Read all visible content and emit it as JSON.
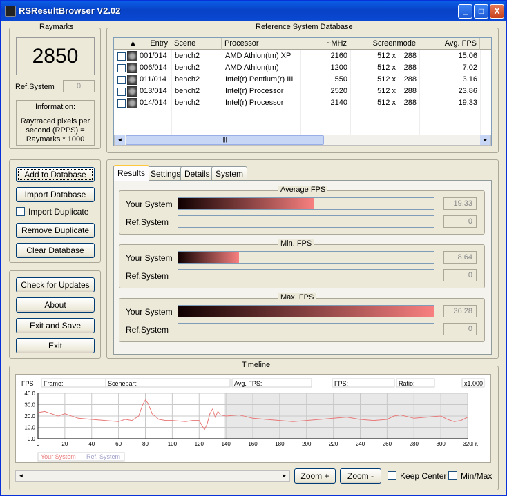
{
  "window": {
    "title": "RSResultBrowser V2.02",
    "minimize": "_",
    "maximize": "□",
    "close": "X"
  },
  "raymarks": {
    "label": "Raymarks",
    "score": "2850",
    "ref_label": "Ref.System",
    "ref_value": "0",
    "info_title": "Information:",
    "info_text": "Raytraced pixels per second (RPPS) = Raymarks * 1000"
  },
  "db_buttons": {
    "add": "Add to Database",
    "import": "Import Database",
    "import_dup": "Import Duplicate",
    "remove_dup": "Remove Duplicate",
    "clear": "Clear Database"
  },
  "misc_buttons": {
    "check": "Check for Updates",
    "about": "About",
    "exit_save": "Exit and Save",
    "exit": "Exit"
  },
  "ref_db": {
    "label": "Reference System Database",
    "sort_icon": "▲",
    "columns": [
      "Entry",
      "Scene",
      "Processor",
      "~MHz",
      "Screenmode",
      "Avg. FPS"
    ],
    "rows": [
      {
        "entry": "001/014",
        "scene": "bench2",
        "processor": "AMD Athlon(tm) XP",
        "mhz": "2160",
        "w": "512 x",
        "h": "288",
        "fps": "15.06"
      },
      {
        "entry": "006/014",
        "scene": "bench2",
        "processor": "AMD Athlon(tm)",
        "mhz": "1200",
        "w": "512 x",
        "h": "288",
        "fps": "7.02"
      },
      {
        "entry": "011/014",
        "scene": "bench2",
        "processor": "Intel(r) Pentium(r) III",
        "mhz": "550",
        "w": "512 x",
        "h": "288",
        "fps": "3.16"
      },
      {
        "entry": "013/014",
        "scene": "bench2",
        "processor": "Intel(r) Processor",
        "mhz": "2520",
        "w": "512 x",
        "h": "288",
        "fps": "23.86"
      },
      {
        "entry": "014/014",
        "scene": "bench2",
        "processor": "Intel(r) Processor",
        "mhz": "2140",
        "w": "512 x",
        "h": "288",
        "fps": "19.33"
      }
    ],
    "hscroll_grip": "|||"
  },
  "tabs": [
    "Results",
    "Settings",
    "Details",
    "System"
  ],
  "results": [
    {
      "title": "Average FPS",
      "your_label": "Your System",
      "ref_label": "Ref.System",
      "your_value": "19.33",
      "ref_value": "0",
      "your_fraction": 0.532
    },
    {
      "title": "Min. FPS",
      "your_label": "Your System",
      "ref_label": "Ref.System",
      "your_value": "8.64",
      "ref_value": "0",
      "your_fraction": 0.238
    },
    {
      "title": "Max. FPS",
      "your_label": "Your System",
      "ref_label": "Ref.System",
      "your_value": "36.28",
      "ref_value": "0",
      "your_fraction": 1.0
    }
  ],
  "timeline": {
    "label": "Timeline",
    "fps_label": "FPS",
    "frame_label": "Frame:",
    "scenepart_label": "Scenepart:",
    "avgfps_label": "Avg. FPS:",
    "fps2_label": "FPS:",
    "ratio_label": "Ratio:",
    "zoom_label": "x1.000",
    "x_unit": "Fr.",
    "legend_your": "Your System",
    "legend_ref": "Ref. System",
    "grid_color": "#c8c8c8",
    "line_color": "#e87878"
  },
  "chart_data": {
    "type": "line",
    "xlabel": "Fr.",
    "ylabel": "FPS",
    "xlim": [
      0,
      320
    ],
    "ylim": [
      0,
      40
    ],
    "x_ticks": [
      0,
      20,
      40,
      60,
      80,
      100,
      120,
      140,
      160,
      180,
      200,
      220,
      240,
      260,
      280,
      300,
      320
    ],
    "y_ticks": [
      "0.0",
      "10.0",
      "20.0",
      "30.0",
      "40.0"
    ],
    "y_tick_values": [
      0,
      10,
      20,
      30,
      40
    ],
    "shaded_from": 139,
    "shaded_to": 320,
    "series": [
      {
        "name": "Your System",
        "color": "#e87878",
        "x": [
          0,
          5,
          10,
          15,
          20,
          30,
          40,
          50,
          60,
          65,
          70,
          75,
          78,
          80,
          82,
          85,
          90,
          95,
          100,
          110,
          115,
          120,
          122,
          124,
          126,
          128,
          130,
          132,
          134,
          136,
          140,
          150,
          160,
          170,
          180,
          190,
          200,
          210,
          220,
          230,
          240,
          250,
          260,
          265,
          270,
          280,
          290,
          300,
          305,
          310,
          315,
          320
        ],
        "y": [
          23,
          24,
          22,
          20,
          22,
          18,
          17,
          16,
          15,
          17,
          16,
          20,
          30,
          34,
          31,
          22,
          17,
          16,
          16,
          15,
          16,
          16,
          12,
          8,
          13,
          22,
          26,
          19,
          24,
          21,
          20,
          21,
          18,
          17,
          16,
          15,
          16,
          17,
          18,
          19,
          17,
          16,
          17,
          20,
          21,
          18,
          19,
          20,
          17,
          15,
          16,
          19
        ]
      },
      {
        "name": "Ref. System",
        "color": "#a0a0c8",
        "x": [],
        "y": []
      }
    ]
  },
  "bottom": {
    "zoom_in": "Zoom +",
    "zoom_out": "Zoom -",
    "keep_center": "Keep Center",
    "minmax": "Min/Max",
    "left_arrow": "◄",
    "right_arrow": "►"
  }
}
